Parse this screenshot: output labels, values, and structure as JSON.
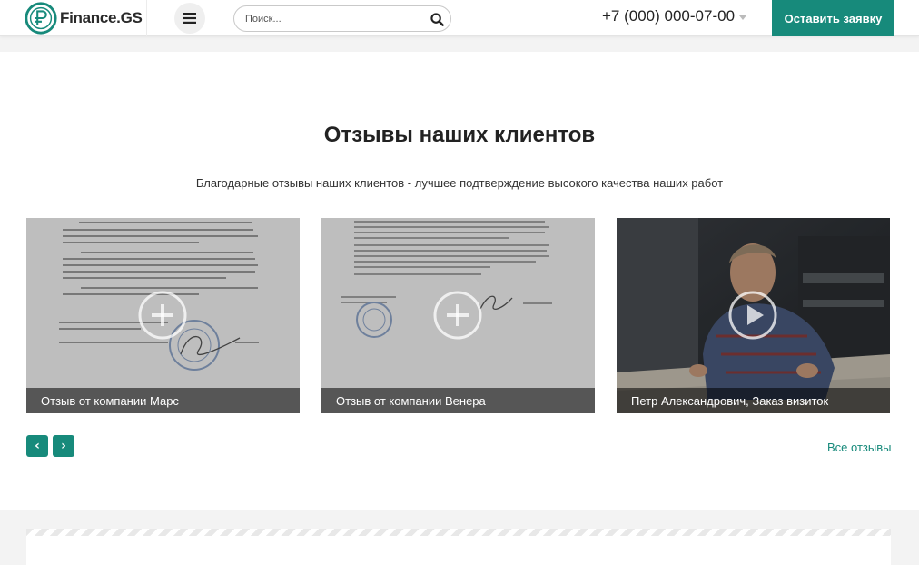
{
  "header": {
    "logo_text": "Finance.GS",
    "search_placeholder": "Поиск...",
    "phone": "+7 (000) 000-07-00",
    "cta_label": "Оставить заявку"
  },
  "reviews": {
    "title": "Отзывы наших клиентов",
    "subtitle": "Благодарные отзывы наших клиентов - лучшее подтверждение высокого качества наших работ",
    "cards": [
      {
        "caption": "Отзыв от компании Марс",
        "icon": "plus-icon"
      },
      {
        "caption": "Отзыв от компании Венера",
        "icon": "plus-icon"
      },
      {
        "caption": "Петр Александрович, Заказ визиток",
        "icon": "play-icon"
      }
    ],
    "prev_label": "‹",
    "next_label": "›",
    "all_link": "Все отзывы"
  },
  "colors": {
    "accent": "#178a7b",
    "text": "#222222"
  }
}
